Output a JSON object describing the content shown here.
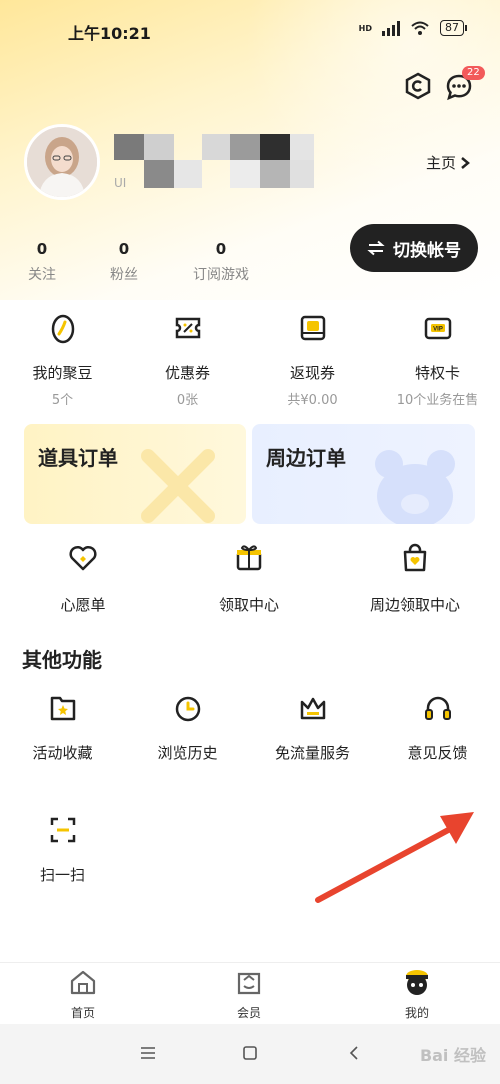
{
  "status_bar": {
    "time": "上午10:21",
    "battery": "87",
    "hd": "HD"
  },
  "header": {
    "message_badge": "22"
  },
  "profile": {
    "homepage_link": "主页",
    "uid_prefix": "UI"
  },
  "stats": [
    {
      "value": "0",
      "label": "关注"
    },
    {
      "value": "0",
      "label": "粉丝"
    },
    {
      "value": "0",
      "label": "订阅游戏"
    }
  ],
  "switch_account": "切换帐号",
  "wallet": [
    {
      "title": "我的聚豆",
      "sub": "5个"
    },
    {
      "title": "优惠券",
      "sub": "0张"
    },
    {
      "title": "返现券",
      "sub": "共¥0.00"
    },
    {
      "title": "特权卡",
      "sub": "10个业务在售"
    }
  ],
  "order_cards": [
    {
      "title": "道具订单"
    },
    {
      "title": "周边订单"
    }
  ],
  "shortcuts": [
    {
      "label": "心愿单"
    },
    {
      "label": "领取中心"
    },
    {
      "label": "周边领取中心"
    }
  ],
  "other_section": {
    "title": "其他功能",
    "items": [
      {
        "label": "活动收藏"
      },
      {
        "label": "浏览历史"
      },
      {
        "label": "免流量服务"
      },
      {
        "label": "意见反馈"
      },
      {
        "label": "扫一扫"
      }
    ]
  },
  "bottom_nav": [
    {
      "label": "首页"
    },
    {
      "label": "会员"
    },
    {
      "label": "我的"
    }
  ],
  "colors": {
    "accent": "#f5c400",
    "dark": "#222222",
    "arrow": "#e8442e"
  },
  "watermark": "Bai 经验"
}
